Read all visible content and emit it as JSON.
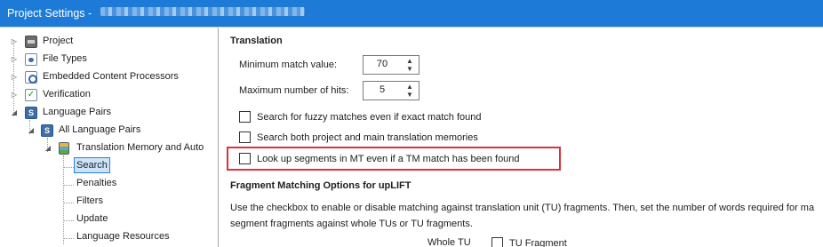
{
  "window": {
    "title": "Project Settings - ",
    "accent_color": "#1d7ad6",
    "highlight_color": "#e0303a"
  },
  "tree": {
    "items": [
      {
        "label": "Project",
        "icon": "project-icon"
      },
      {
        "label": "File Types",
        "icon": "document-icon"
      },
      {
        "label": "Embedded Content Processors",
        "icon": "gear-icon"
      },
      {
        "label": "Verification",
        "icon": "checkmark-icon"
      },
      {
        "label": "Language Pairs",
        "icon": "language-pair-icon"
      },
      {
        "label": "All Language Pairs",
        "icon": "language-pair-icon"
      },
      {
        "label": "Translation Memory and Auto",
        "icon": "translation-memory-icon"
      },
      {
        "label": "Search",
        "selected": true
      },
      {
        "label": "Penalties"
      },
      {
        "label": "Filters"
      },
      {
        "label": "Update"
      },
      {
        "label": "Language Resources"
      }
    ]
  },
  "translation": {
    "heading": "Translation",
    "min_match_label": "Minimum match value:",
    "min_match_value": "70",
    "max_hits_label": "Maximum number of hits:",
    "max_hits_value": "5",
    "checkboxes": [
      {
        "label": "Search for fuzzy matches even if exact match found",
        "checked": false
      },
      {
        "label": "Search both project and main translation memories",
        "checked": false
      },
      {
        "label": "Look up segments in MT even if a TM match has been found",
        "checked": false
      }
    ]
  },
  "fragment": {
    "heading": "Fragment Matching Options for upLIFT",
    "description_line1": "Use the checkbox to enable or disable matching against translation unit (TU)  fragments. Then, set the number of words required for ma",
    "description_line2": "segment fragments against whole TUs or TU fragments.",
    "whole_tu_label": "Whole TU",
    "tu_fragment_label": "TU Fragment"
  }
}
